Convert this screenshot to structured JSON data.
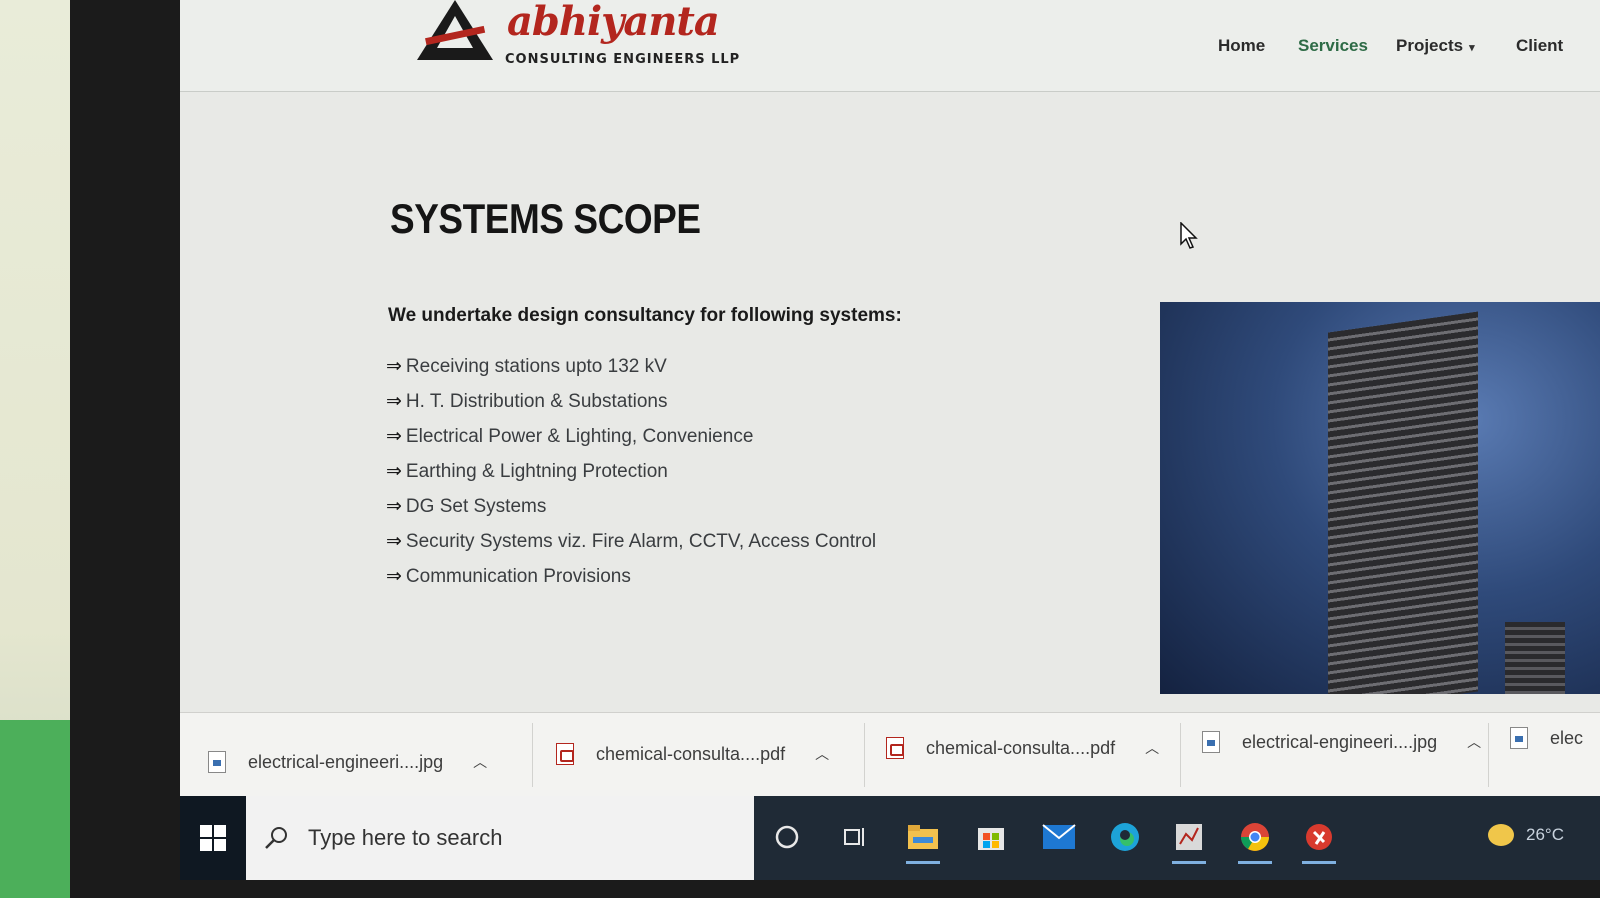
{
  "header": {
    "logo": {
      "name": "abhiyanta",
      "subtitle": "CONSULTING ENGINEERS LLP"
    },
    "nav": [
      {
        "label": "Home"
      },
      {
        "label": "Services"
      },
      {
        "label": "Projects",
        "has_dropdown": true
      },
      {
        "label": "Client"
      }
    ]
  },
  "main": {
    "title": "SYSTEMS SCOPE",
    "intro": "We undertake design consultancy for following systems:",
    "arrow": "⇒",
    "items": [
      "Receiving stations upto 132 kV",
      "H. T. Distribution & Substations",
      "Electrical Power & Lighting, Convenience",
      "Earthing & Lightning Protection",
      "DG Set Systems",
      "Security Systems viz. Fire Alarm, CCTV, Access Control",
      "Communication Provisions"
    ]
  },
  "downloads": [
    {
      "name": "electrical-engineeri....jpg",
      "type": "jpg"
    },
    {
      "name": "chemical-consulta....pdf",
      "type": "pdf"
    },
    {
      "name": "chemical-consulta....pdf",
      "type": "pdf"
    },
    {
      "name": "electrical-engineeri....jpg",
      "type": "jpg"
    },
    {
      "name": "elec",
      "type": "jpg"
    }
  ],
  "taskbar": {
    "search_placeholder": "Type here to search",
    "icons": [
      "cortana-icon",
      "task-view-icon",
      "file-explorer-icon",
      "store-icon",
      "mail-icon",
      "edge-icon",
      "app-icon",
      "chrome-icon",
      "app-red-icon"
    ],
    "weather": "26°C"
  },
  "colors": {
    "brand_red": "#b3261e",
    "nav_active": "#2e6b46",
    "taskbar": "#1f2a36"
  }
}
